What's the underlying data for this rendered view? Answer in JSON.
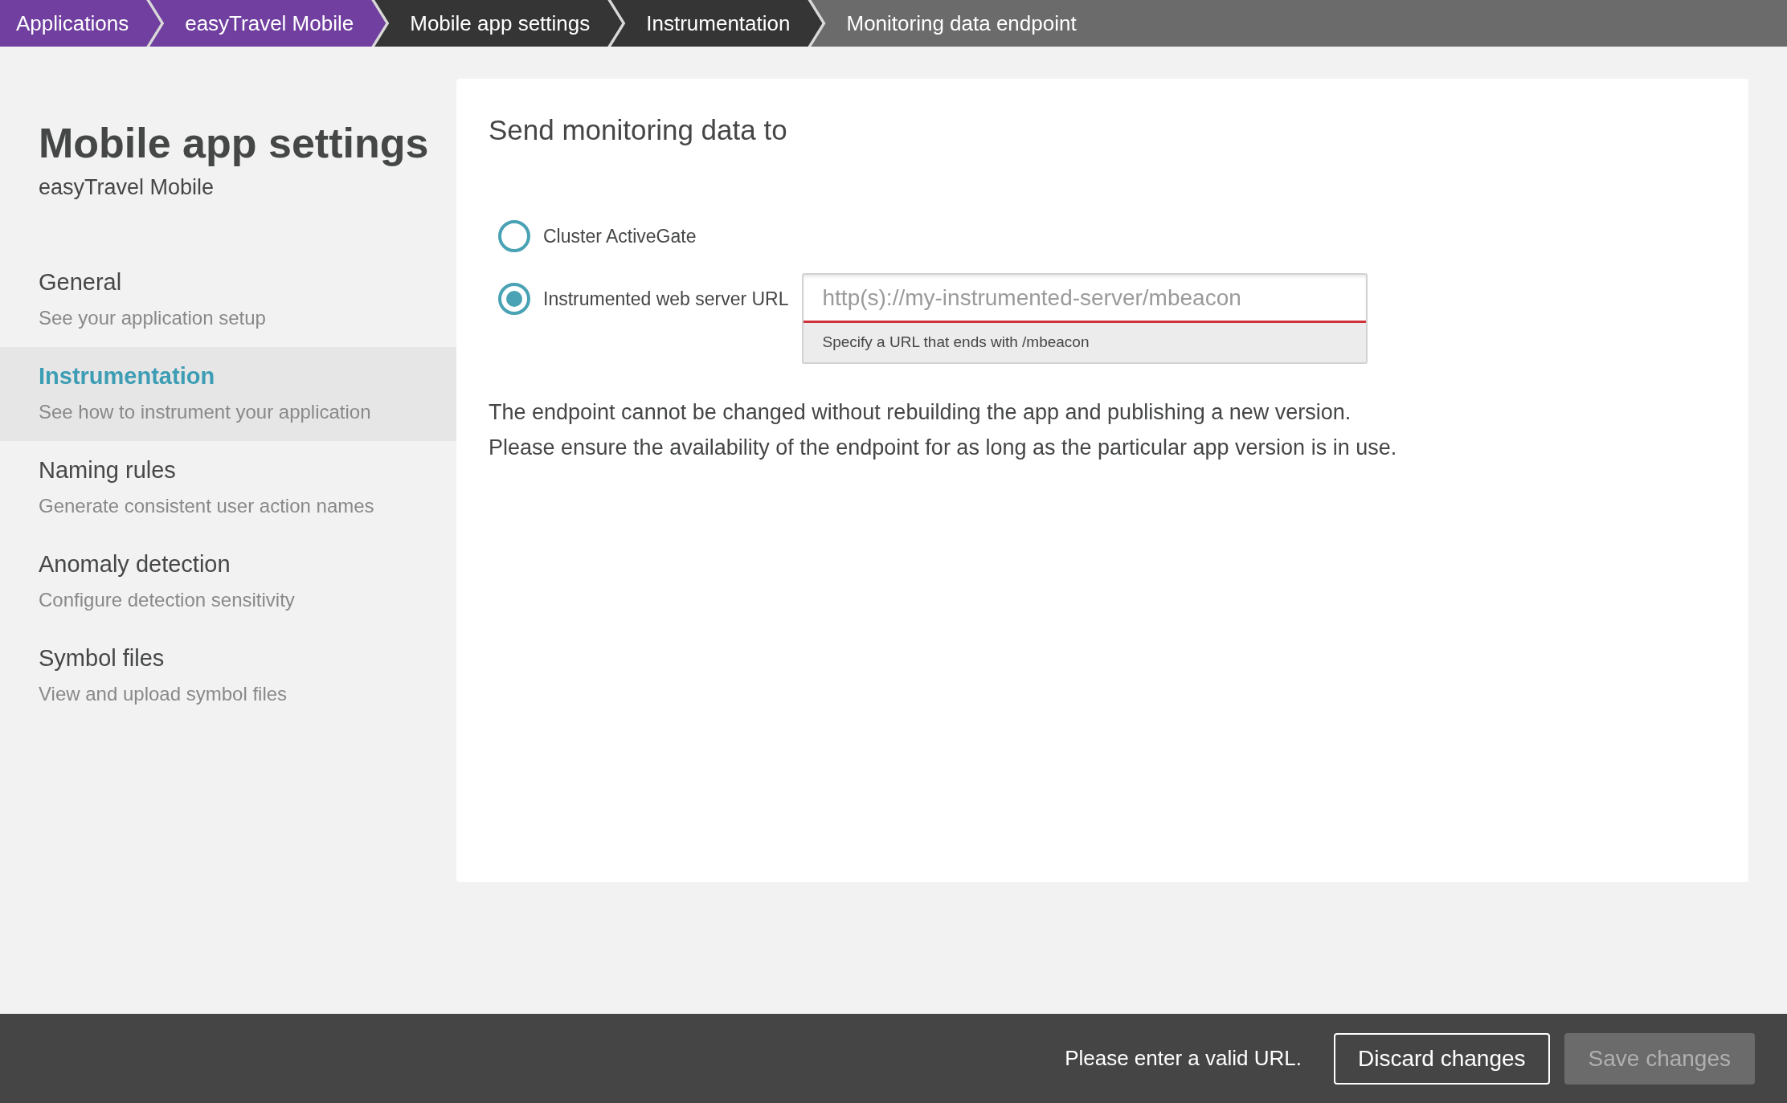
{
  "breadcrumbs": [
    {
      "label": "Applications",
      "kind": "app"
    },
    {
      "label": "easyTravel Mobile",
      "kind": "app"
    },
    {
      "label": "Mobile app settings",
      "kind": "dark"
    },
    {
      "label": "Instrumentation",
      "kind": "dark"
    },
    {
      "label": "Monitoring data endpoint",
      "kind": "current"
    }
  ],
  "sidebar": {
    "title": "Mobile app settings",
    "subtitle": "easyTravel Mobile",
    "items": [
      {
        "title": "General",
        "description": "See your application setup",
        "selected": false
      },
      {
        "title": "Instrumentation",
        "description": "See how to instrument your application",
        "selected": true
      },
      {
        "title": "Naming rules",
        "description": "Generate consistent user action names",
        "selected": false
      },
      {
        "title": "Anomaly detection",
        "description": "Configure detection sensitivity",
        "selected": false
      },
      {
        "title": "Symbol files",
        "description": "View and upload symbol files",
        "selected": false
      }
    ]
  },
  "panel": {
    "heading": "Send monitoring data to",
    "options": [
      {
        "label": "Cluster ActiveGate",
        "selected": false
      },
      {
        "label": "Instrumented web server URL",
        "selected": true,
        "field": {
          "placeholder": "http(s)://my-instrumented-server/mbeacon",
          "hint": "Specify a URL that ends with /mbeacon",
          "invalid": true
        }
      }
    ],
    "note": "The endpoint cannot be changed without rebuilding the app and publishing a new version. Please ensure the availability of the endpoint for as long as the particular app version is in use."
  },
  "footer": {
    "message": "Please enter a valid URL.",
    "buttons": [
      {
        "label": "Discard changes",
        "disabled": false
      },
      {
        "label": "Save changes",
        "disabled": true
      }
    ]
  }
}
